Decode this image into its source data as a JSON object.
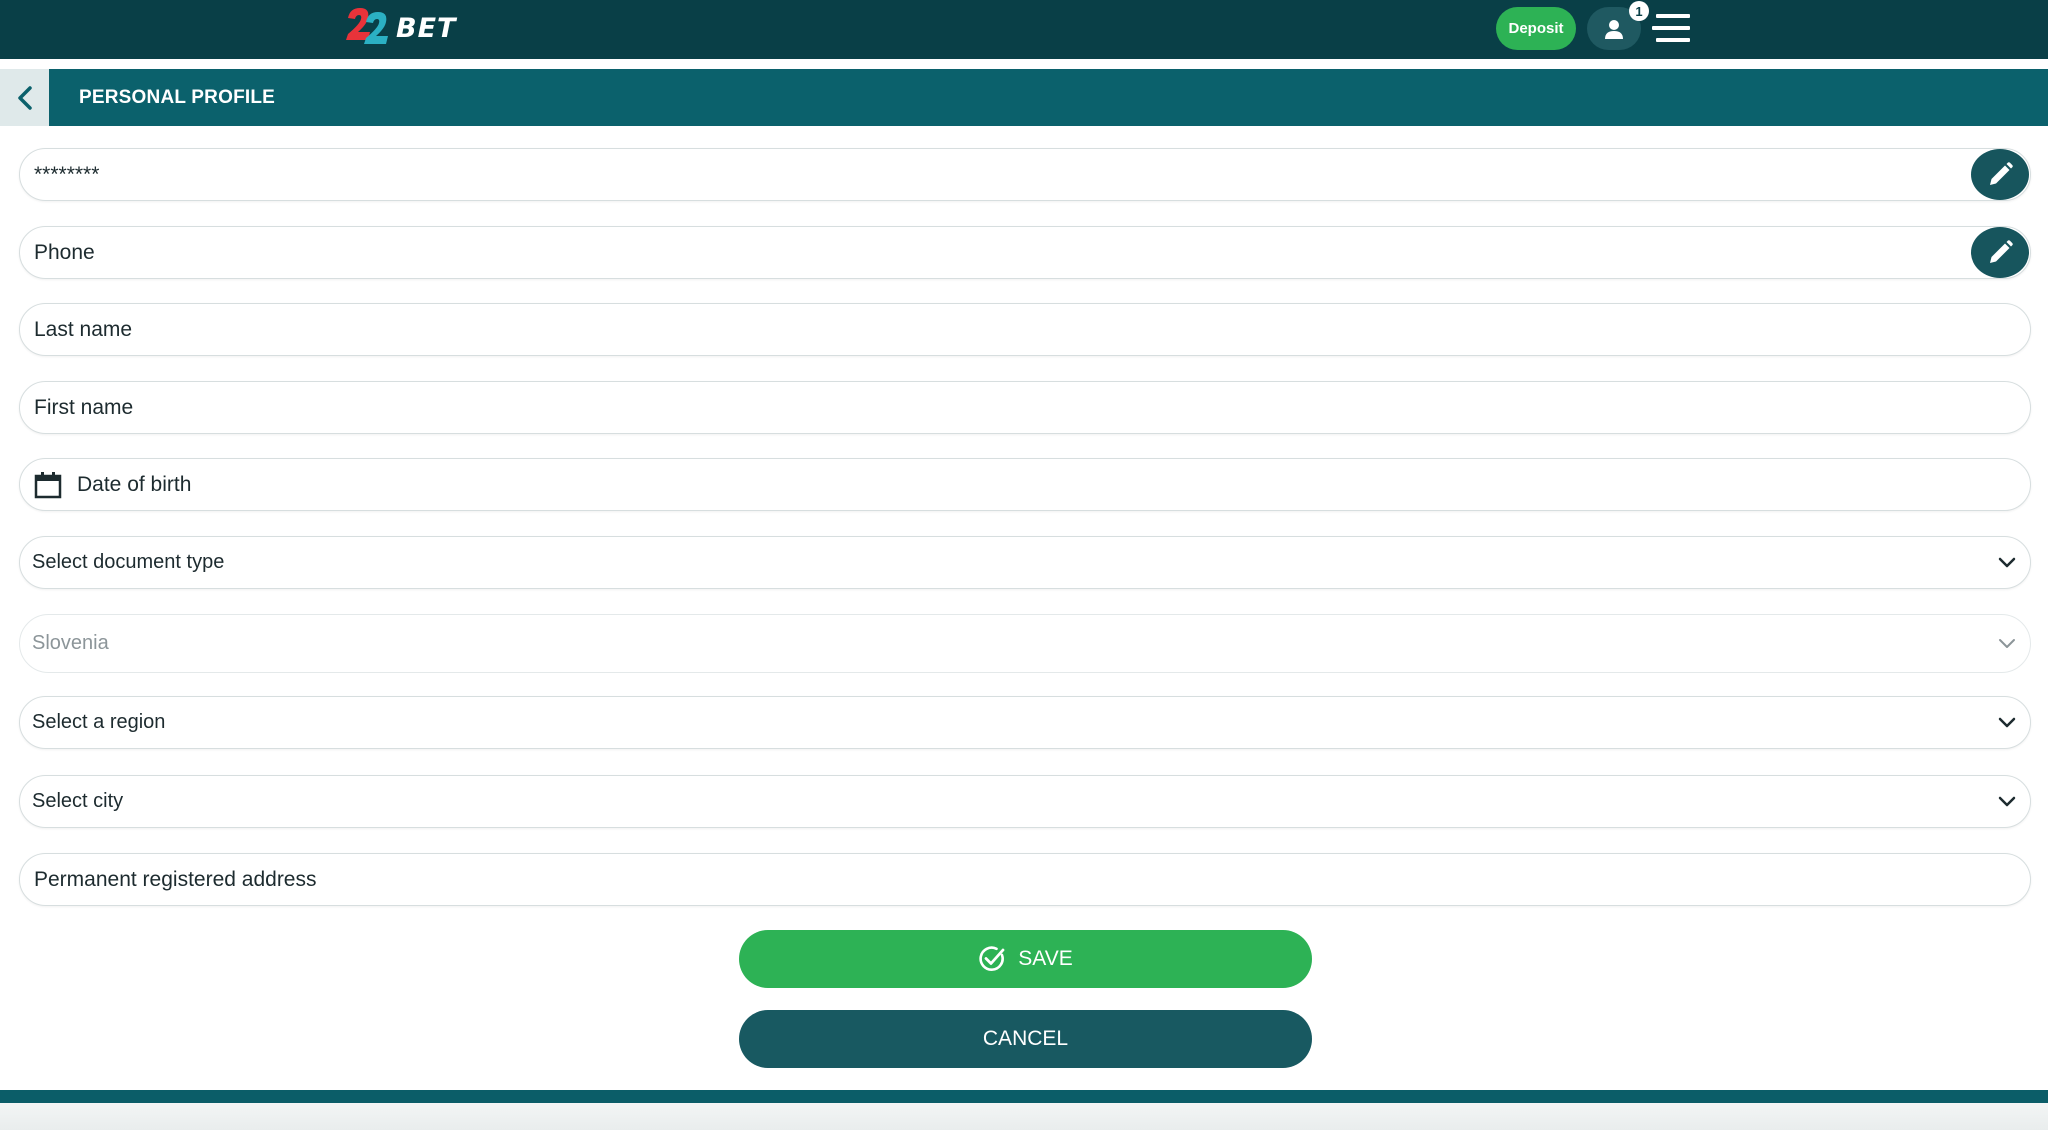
{
  "header": {
    "logo_text": "BET",
    "logo_number": "22",
    "deposit_label": "Deposit",
    "notification_count": "1"
  },
  "section": {
    "title": "PERSONAL PROFILE"
  },
  "fields": [
    {
      "label": "********",
      "kind": "password",
      "editable": true
    },
    {
      "label": "Phone",
      "kind": "phone",
      "editable": true
    },
    {
      "label": "Last name",
      "kind": "text"
    },
    {
      "label": "First name",
      "kind": "text"
    },
    {
      "label": "Date of birth",
      "kind": "date"
    },
    {
      "label": "Select document type",
      "kind": "select"
    },
    {
      "label": "Slovenia",
      "kind": "select",
      "disabled": true
    },
    {
      "label": "Select a region",
      "kind": "select"
    },
    {
      "label": "Select city",
      "kind": "select"
    },
    {
      "label": "Permanent registered address",
      "kind": "text"
    }
  ],
  "actions": {
    "save_label": "SAVE",
    "cancel_label": "CANCEL"
  },
  "colors": {
    "topbar": "#093f47",
    "section_header": "#0b616c",
    "primary_green": "#2db255",
    "dark_teal": "#185961"
  },
  "icons": [
    "logo-icon",
    "user-icon",
    "hamburger-menu-icon",
    "chevron-left-icon",
    "pencil-icon",
    "calendar-icon",
    "chevron-down-icon",
    "check-circle-icon"
  ]
}
